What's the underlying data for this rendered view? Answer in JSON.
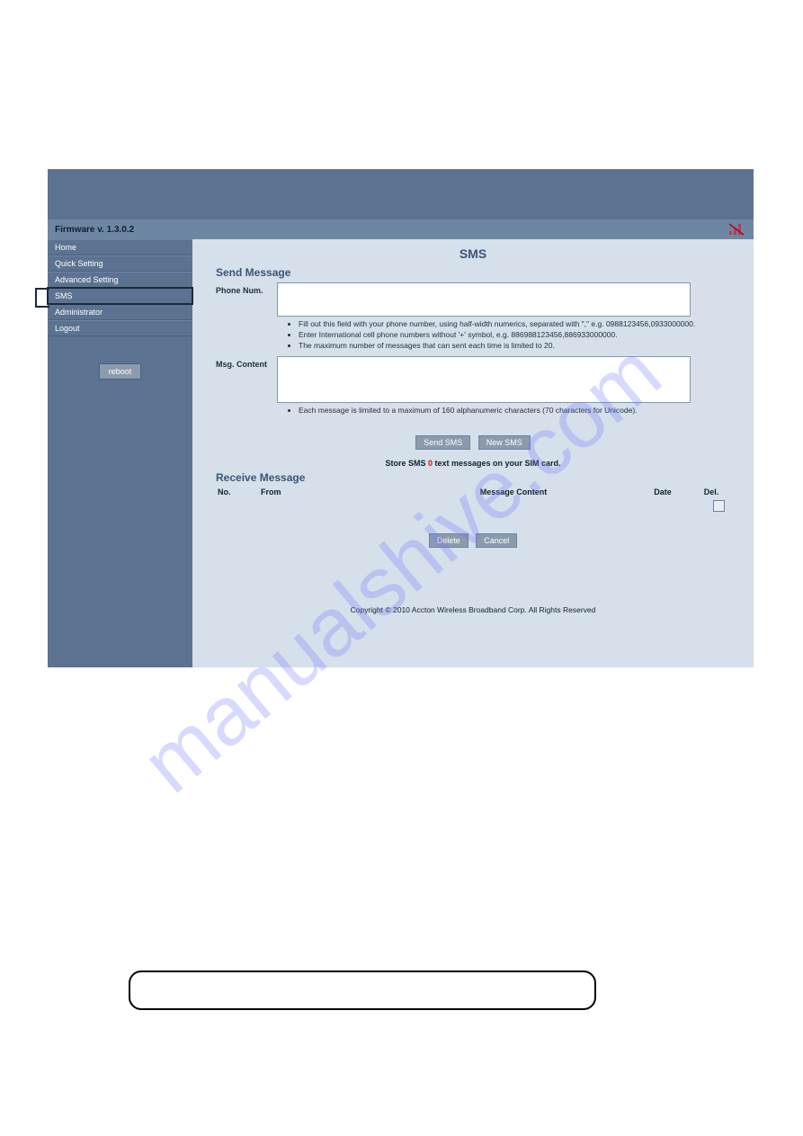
{
  "page": {
    "watermark": "manualshive.com"
  },
  "firmware_label": "Firmware v.   1.3.0.2",
  "nav": {
    "home": "Home",
    "quick": "Quick Setting",
    "advanced": "Advanced Setting",
    "sms": "SMS",
    "admin": "Administrator",
    "logout": "Logout"
  },
  "reboot_label": "reboot",
  "content": {
    "title": "SMS",
    "send_title": "Send Message",
    "phone_label": "Phone Num.",
    "phone_hints": [
      "Fill out this field with your phone number, using half-width numerics, separated with \",\" e.g. 0988123456,0933000000.",
      "Enter International cell phone numbers without '+' symbol, e.g. 886988123456,886933000000.",
      "The maximum number of messages that can sent each time is limited to 20."
    ],
    "msg_label": "Msg. Content",
    "msg_hint": "Each message is limited to a maximum of 160 alphanumeric characters (70 characters for Unicode).",
    "send_btn": "Send SMS",
    "new_btn": "New SMS",
    "store_prefix": "Store SMS ",
    "store_count": "0",
    "store_suffix": "  text messages on your SIM card.",
    "recv_title": "Receive Message",
    "cols": {
      "no": "No.",
      "from": "From",
      "content": "Message Content",
      "date": "Date",
      "del": "Del."
    },
    "delete_btn": "Delete",
    "cancel_btn": "Cancel",
    "copyright": "Copyright © 2010 Accton Wireless Broadband Corp. All Rights Reserved"
  }
}
